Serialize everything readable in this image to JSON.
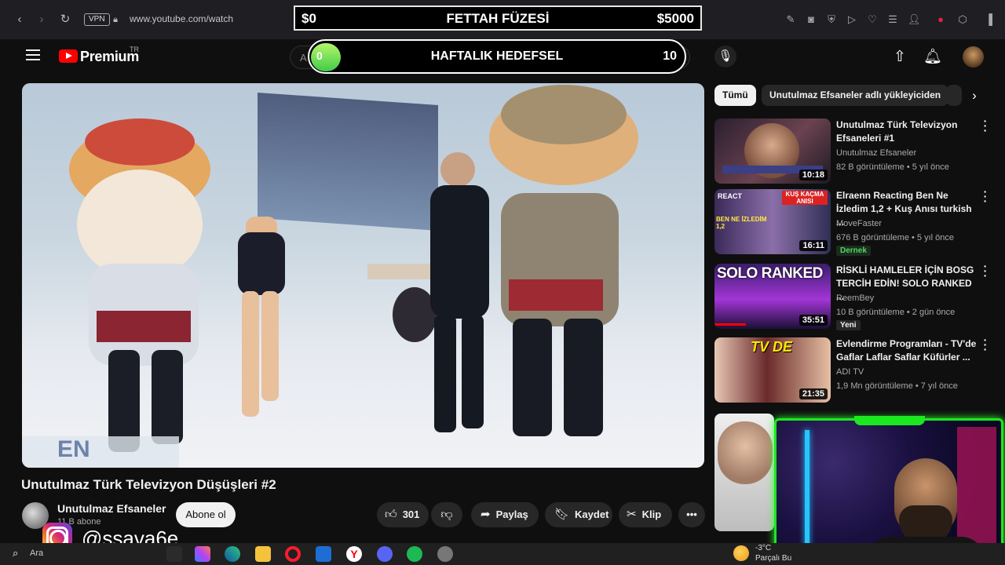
{
  "browser": {
    "url": "www.youtube.com/watch",
    "vpn_label": "VPN"
  },
  "goal_banner": {
    "left": "$0",
    "title": "FETTAH FÜZESİ",
    "right": "$5000"
  },
  "weekly_goal": {
    "start": "0",
    "title": "HAFTALIK HEDEFSEL",
    "end": "10",
    "progress": 0
  },
  "header": {
    "brand": "Premium",
    "region": "TR",
    "search_peek": "A"
  },
  "video": {
    "title": "Unutulmaz Türk Televizyon Düşüşleri #2",
    "channel": "Unutulmaz Efsaneler",
    "subscribers": "11 B abone",
    "subscribe_label": "Abone ol",
    "likes": "301",
    "share_label": "Paylaş",
    "save_label": "Kaydet",
    "clip_label": "Klip",
    "scene_text": "EN"
  },
  "chips": [
    {
      "label": "Tümü"
    },
    {
      "label": "Unutulmaz Efsaneler adlı yükleyiciden"
    }
  ],
  "recommendations": [
    {
      "title": "Unutulmaz Türk Televizyon Efsaneleri #1",
      "channel": "Unutulmaz Efsaneler",
      "meta": "82 B görüntüleme • 5 yıl önce",
      "duration": "10:18",
      "badge": ""
    },
    {
      "title": "Elraenn Reacting Ben Ne İzledim 1,2 + Kuş Anısı turkish ...",
      "channel": "MoveFaster",
      "meta": "676 B görüntüleme • 5 yıl önce",
      "duration": "16:11",
      "badge": "Dernek"
    },
    {
      "title": "RİSKLİ HAMLELER İÇİN BOSG TERCİH EDİN! SOLO RANKED ...",
      "channel": "ReemBey",
      "meta": "10 B görüntüleme • 2 gün önce",
      "duration": "35:51",
      "badge": "Yeni"
    },
    {
      "title": "Evlendirme Programları - TV'de Gaflar Laflar Saflar Küfürler ...",
      "channel": "ADI TV",
      "meta": "1,9 Mn görüntüleme • 7 yıl önce",
      "duration": "21:35",
      "badge": ""
    }
  ],
  "thumb_texts": {
    "react": "REACT",
    "kus": "KUŞ KAÇMA ANISI",
    "bnei": "BEN NE İZLEDİM 1,2",
    "solo": "SOLO RANKED",
    "tvde": "TV DE"
  },
  "overlay": {
    "instagram_handle": "@ssava6e"
  },
  "taskbar": {
    "search_peek": "Ara",
    "temp": "-3°C",
    "weather": "Parçalı Bu"
  },
  "colors": {
    "accent_red": "#ff0000",
    "webcam_border": "#1be81f",
    "background": "#0f0f0f"
  }
}
